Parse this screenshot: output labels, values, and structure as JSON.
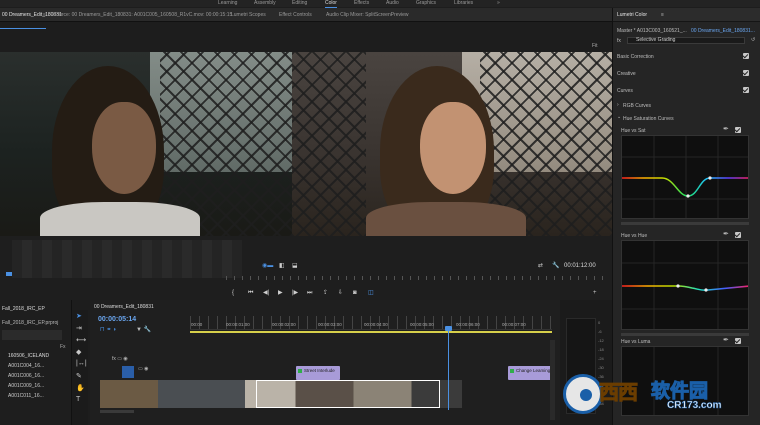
{
  "workspaces": {
    "items": [
      "Learning",
      "Assembly",
      "Editing",
      "Color",
      "Effects",
      "Audio",
      "Graphics",
      "Libraries"
    ],
    "active": "Color",
    "more": "»"
  },
  "tabs": {
    "sequence": "00 Dreamers_Edit_180831",
    "source": "Source: 00 Dreamers_Edit_180831: A001C005_160508_R1vC.mov: 00:00:15:15",
    "scopes": "Lumetri Scopes",
    "effect_controls": "Effect Controls",
    "audio_mixer": "Audio Clip Mixer: SplitScreenPreview"
  },
  "monitor": {
    "fit": "Fit",
    "timecode": "00:01:12:00"
  },
  "lumetri": {
    "title": "Lumetri Color",
    "master": "Master * A013C003_160521_...",
    "clip": "00 Dreamers_Edit_180831...",
    "fx": "fx",
    "effect": "Selective Grading",
    "sections": [
      "Basic Correction",
      "Creative",
      "Curves"
    ],
    "rgb_curves": "RGB Curves",
    "hsl_curves": "Hue Saturation Curves",
    "curve_labels": [
      "Hue vs Sat",
      "Hue vs Hue",
      "Hue vs Luma"
    ]
  },
  "project": {
    "name": "Fall_2018_IRC_EP",
    "file": "Fall_2018_IRC_EP.prproj",
    "bin": "160506_ICELAND",
    "clips": [
      "A001C004_16...",
      "A001C006_16...",
      "A001C009_16...",
      "A001C011_16..."
    ]
  },
  "timeline": {
    "name": "00 Dreamers_Edit_180831",
    "timecode": "00:00:05:14",
    "ruler": [
      "00:00",
      "00:00:01:00",
      "00:00:02:00",
      "00:00:03:00",
      "00:00:04:00",
      "00:00:05:00",
      "00:00:06:00",
      "00:00:07:00"
    ],
    "clip_a": "Street Interlude",
    "clip_b": "Change Leaming"
  },
  "meters": {
    "labels": [
      "0",
      "-6",
      "-12",
      "-18",
      "-24",
      "-30",
      "-36",
      "-42",
      "-48",
      "-54"
    ]
  },
  "watermark": {
    "brand": "西西",
    "site": "软件园",
    "url": "CR173.com"
  },
  "colors": {
    "accent": "#4a90e2",
    "workarea": "#d6cf4a",
    "clip": "#a89bd8"
  }
}
